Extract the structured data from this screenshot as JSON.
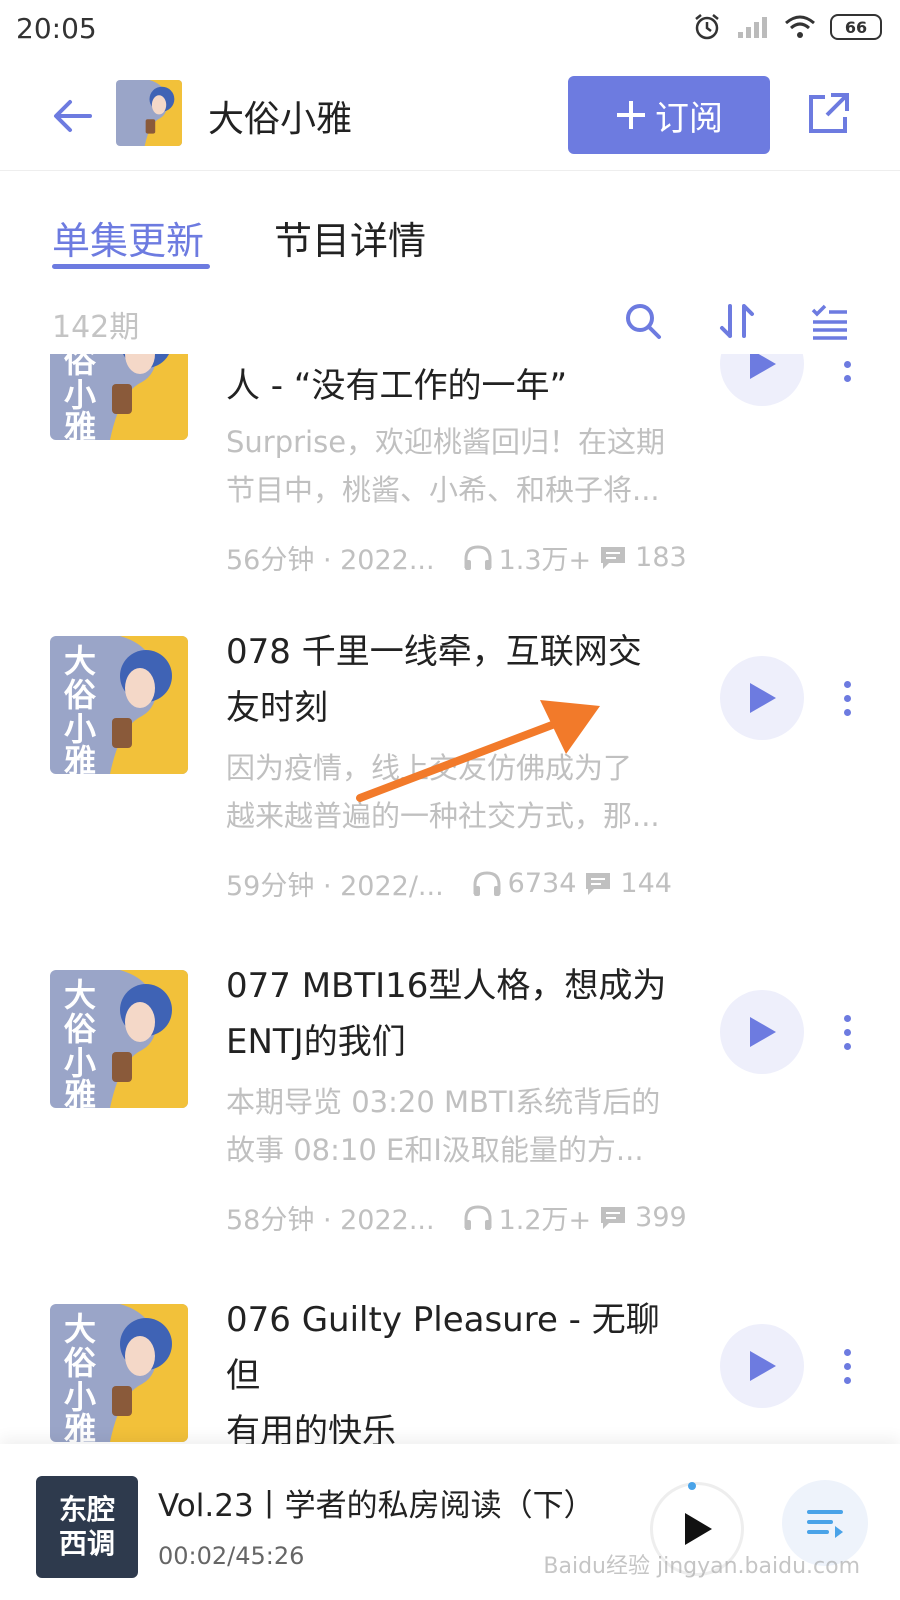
{
  "status": {
    "time": "20:05",
    "battery": "66"
  },
  "header": {
    "title": "大俗小雅",
    "subscribe_label": "订阅"
  },
  "tabs": [
    {
      "label": "单集更新"
    },
    {
      "label": "节目详情"
    }
  ],
  "toolbar": {
    "count": "142期"
  },
  "cover_text": [
    "大",
    "俗",
    "小",
    "雅"
  ],
  "episodes": [
    {
      "title": "人 - “没有工作的一年”",
      "desc": [
        "Surprise，欢迎桃酱回归！在这期",
        "节目中，桃酱、小希、和秧子将..."
      ],
      "duration_date": "56分钟 · 2022...",
      "plays": "1.3万+",
      "comments": "183"
    },
    {
      "title_lines": [
        "078 千里一线牵，互联网交",
        "友时刻"
      ],
      "desc": [
        "因为疫情，线上交友仿佛成为了",
        "越来越普遍的一种社交方式，那..."
      ],
      "duration_date": "59分钟 · 2022/...",
      "plays": "6734",
      "comments": "144"
    },
    {
      "title_lines": [
        "077 MBTI16型人格，想成为",
        "ENTJ的我们"
      ],
      "desc": [
        "本期导览 03:20 MBTI系统背后的",
        "故事 08:10 E和I汲取能量的方..."
      ],
      "duration_date": "58分钟 · 2022...",
      "plays": "1.2万+",
      "comments": "399"
    },
    {
      "title_lines": [
        "076 Guilty Pleasure - 无聊但",
        "有用的快乐"
      ]
    }
  ],
  "player": {
    "cover_text": [
      "东腔",
      "西调"
    ],
    "title": "Vol.23丨学者的私房阅读（下）",
    "time": "00:02/45:26"
  },
  "watermark": "Baidu经验 jingyan.baidu.com",
  "colors": {
    "accent": "#6d7be0",
    "muted": "#c0c0c0",
    "annotation_arrow": "#f27a2a"
  }
}
